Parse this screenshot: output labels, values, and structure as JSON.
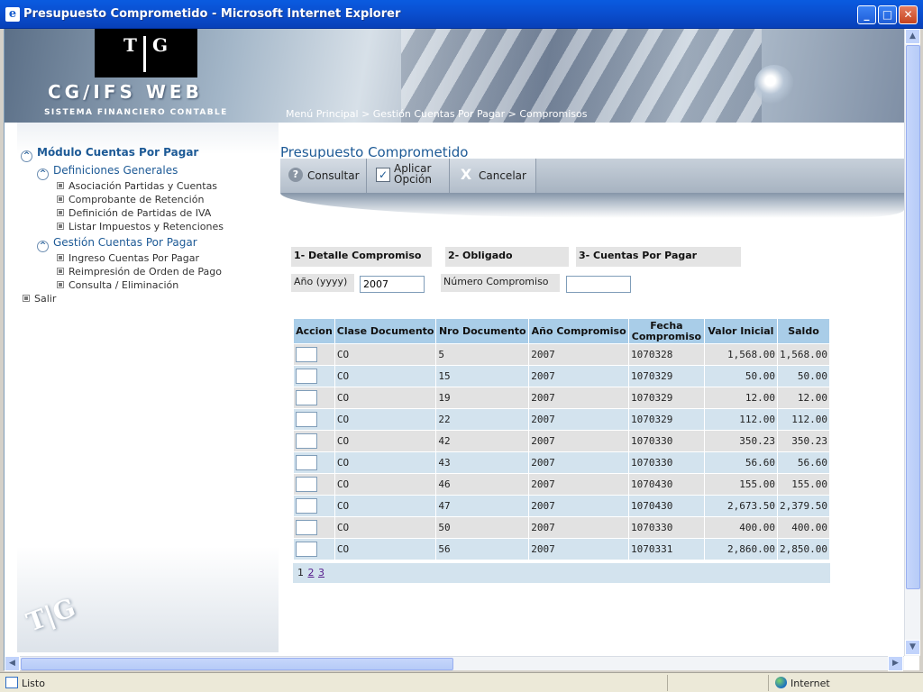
{
  "window": {
    "title": "Presupuesto Comprometido - Microsoft Internet Explorer",
    "app_icon": "e",
    "buttons": {
      "minimize": "_",
      "maximize": "□",
      "close": "✕"
    }
  },
  "banner": {
    "logo_t": "T",
    "logo_g": "G",
    "brand": "CG/IFS  WEB",
    "tagline": "SISTEMA FINANCIERO CONTABLE",
    "breadcrumb": "Menú Principal > Gestión Cuentas Por Pagar > Compromisos"
  },
  "sidebar": {
    "module": "Módulo Cuentas Por Pagar",
    "group1": "Definiciones Generales",
    "group1_items": [
      "Asociación Partidas y Cuentas",
      "Comprobante de Retención",
      "Definición de Partidas de IVA",
      "Listar Impuestos y Retenciones"
    ],
    "group2": "Gestión Cuentas Por Pagar",
    "group2_items": [
      "Ingreso Cuentas Por Pagar",
      "Reimpresión de Orden de Pago",
      "Consulta / Eliminación"
    ],
    "exit": "Salir",
    "bottom_logo": "T|G"
  },
  "main": {
    "title": "Presupuesto Comprometido",
    "toolbar": {
      "consultar": "Consultar",
      "aplicar_line1": "Aplicar",
      "aplicar_line2": "Opción",
      "cancelar": "Cancelar"
    },
    "tabs": [
      "1- Detalle Compromiso",
      "2- Obligado",
      "3- Cuentas Por Pagar"
    ],
    "year_label": "Año (yyyy)",
    "year_value": "2007",
    "number_label": "Número Compromiso",
    "number_value": ""
  },
  "table": {
    "headers": [
      "Accion",
      "Clase Documento",
      "Nro Documento",
      "Año Compromiso",
      "Fecha Compromiso",
      "Valor Inicial",
      "Saldo"
    ],
    "rows": [
      [
        "CO",
        "5",
        "2007",
        "1070328",
        "1,568.00",
        "1,568.00"
      ],
      [
        "CO",
        "15",
        "2007",
        "1070329",
        "50.00",
        "50.00"
      ],
      [
        "CO",
        "19",
        "2007",
        "1070329",
        "12.00",
        "12.00"
      ],
      [
        "CO",
        "22",
        "2007",
        "1070329",
        "112.00",
        "112.00"
      ],
      [
        "CO",
        "42",
        "2007",
        "1070330",
        "350.23",
        "350.23"
      ],
      [
        "CO",
        "43",
        "2007",
        "1070330",
        "56.60",
        "56.60"
      ],
      [
        "CO",
        "46",
        "2007",
        "1070430",
        "155.00",
        "155.00"
      ],
      [
        "CO",
        "47",
        "2007",
        "1070430",
        "2,673.50",
        "2,379.50"
      ],
      [
        "CO",
        "50",
        "2007",
        "1070330",
        "400.00",
        "400.00"
      ],
      [
        "CO",
        "56",
        "2007",
        "1070331",
        "2,860.00",
        "2,850.00"
      ]
    ],
    "pager": [
      "1",
      "2",
      "3"
    ]
  },
  "statusbar": {
    "text": "Listo",
    "zone": "Internet"
  }
}
